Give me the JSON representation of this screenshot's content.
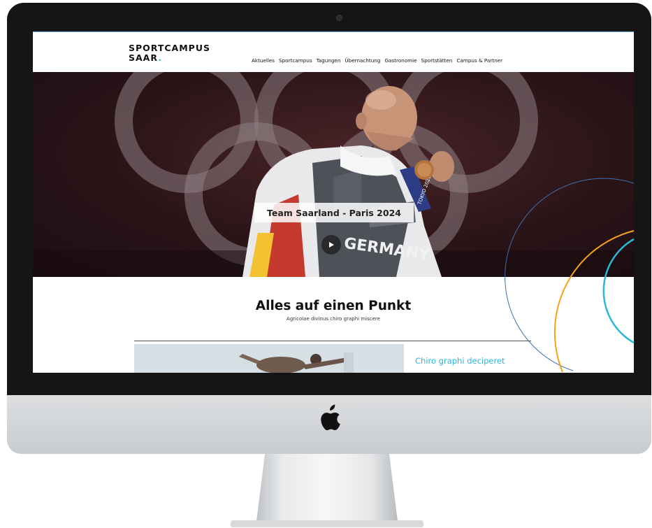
{
  "logo": {
    "line1": "SPORTCAMPUS",
    "line2": "SAAR",
    "dot": "."
  },
  "nav": {
    "items": [
      "Aktuelles",
      "Sportcampus",
      "Tagungen",
      "Übernachtung",
      "Gastronomie",
      "Sportstätten",
      "Campus & Partner"
    ]
  },
  "hero": {
    "caption": "Team Saarland - Paris 2024",
    "jacket_text": "GERMANY",
    "medal_ribbon": "TOKYO 2020",
    "play_icon": "play-icon"
  },
  "section": {
    "title": "Alles auf einen Punkt",
    "subtitle": "Agricolae divinus chiro graphi miscere"
  },
  "feature": {
    "link": "Chiro graphi deciperet"
  },
  "colors": {
    "accent": "#2bb7d6",
    "orange": "#f5a21b",
    "blue_line": "#3c6fb4",
    "hero_bg": "#2a1418"
  }
}
